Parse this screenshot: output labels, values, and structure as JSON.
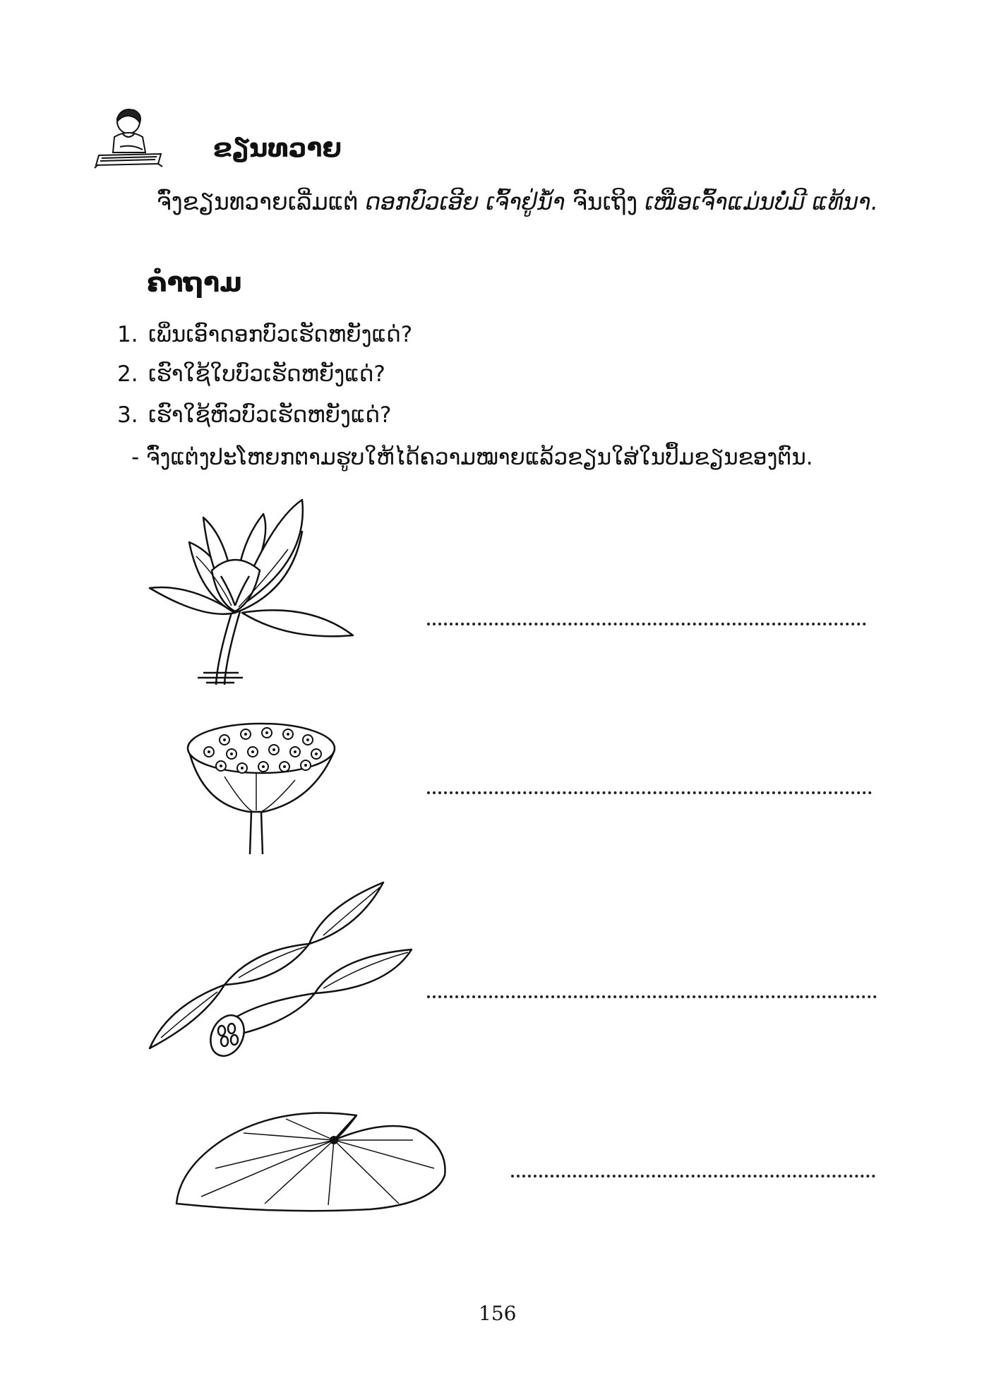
{
  "dictation": {
    "title": "ຂຽນທວາຍ",
    "instruction_prefix": "ຈົ່ງຂຽນທວາຍເລີ່ມແຕ່",
    "start_phrase": "ດອກບົວເອີຍ ເຈົ້າຢູ່ນ້ຳ",
    "instruction_mid": "ຈົນເຖິງ",
    "end_phrase": "ເໜືອເຈົ້າແມ່ນບໍ່ມີ ແທ້ນາ."
  },
  "questions": {
    "title": "ຄຳຖາມ",
    "items": [
      {
        "num": "1.",
        "text": "ເພິ່ນເອົາດອກບົວເຮັດຫຍັງແດ່?"
      },
      {
        "num": "2.",
        "text": "ເຮົາໃຊ້ໃບບົວເຮັດຫຍັງແດ່?"
      },
      {
        "num": "3.",
        "text": "ເຮົາໃຊ້ຫົວບົວເຮັດຫຍັງແດ່?"
      }
    ],
    "task": "- ຈົ່ງແຕ່ງປະໂຫຍກຕາມຮູບໃຫ້ໄດ້ຄວາມໝາຍແລ້ວຂຽນໃສ່ໃນປຶ້ມຂຽນຂອງຕົນ."
  },
  "exercise": {
    "answer_lines": [
      "",
      "",
      "",
      ""
    ]
  },
  "page_number": "156"
}
